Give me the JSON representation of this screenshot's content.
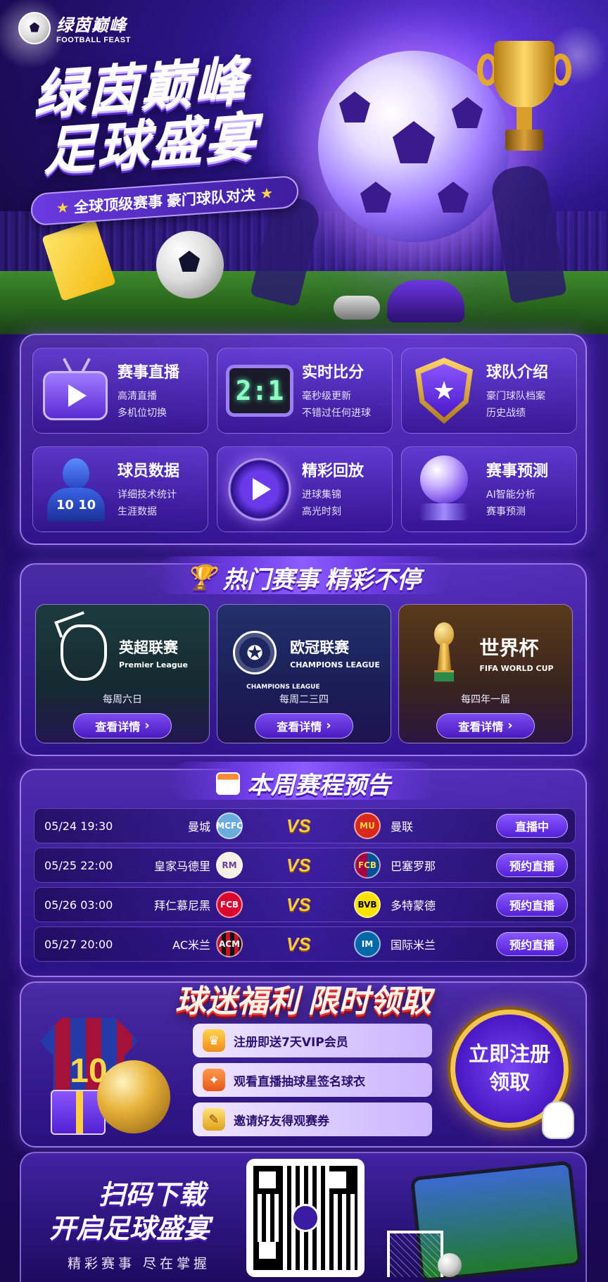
{
  "brand": {
    "name_cn": "绿茵巅峰",
    "name_en": "FOOTBALL FEAST"
  },
  "hero": {
    "title_line1": "绿茵巅峰",
    "title_line2": "足球盛宴",
    "subtitle": "全球顶级赛事 豪门球队对决",
    "star_glyph": "★"
  },
  "features": [
    {
      "title": "赛事直播",
      "desc1": "高清直播",
      "desc2": "多机位切换",
      "icon": "tv-play-icon"
    },
    {
      "title": "实时比分",
      "desc1": "毫秒级更新",
      "desc2": "不错过任何进球",
      "icon": "scoreboard-icon",
      "score": "2:1"
    },
    {
      "title": "球队介绍",
      "desc1": "豪门球队档案",
      "desc2": "历史战绩",
      "icon": "shield-star-icon"
    },
    {
      "title": "球员数据",
      "desc1": "详细技术统计",
      "desc2": "生涯数据",
      "icon": "player-icon",
      "jersey": "10 10"
    },
    {
      "title": "精彩回放",
      "desc1": "进球集锦",
      "desc2": "高光时刻",
      "icon": "replay-icon"
    },
    {
      "title": "赛事预测",
      "desc1": "AI智能分析",
      "desc2": "赛事预测",
      "icon": "crystal-ball-icon"
    }
  ],
  "leagues_section": {
    "title": "热门赛事 精彩不停",
    "items": [
      {
        "name": "英超联赛",
        "name_en": "Premier League",
        "schedule": "每周六日",
        "button": "查看详情"
      },
      {
        "name": "欧冠联赛",
        "name_en": "CHAMPIONS LEAGUE",
        "emblem_text": "CHAMPIONS LEAGUE",
        "schedule": "每周二三四",
        "button": "查看详情"
      },
      {
        "name": "世界杯",
        "name_en": "FIFA WORLD CUP",
        "schedule": "每四年一届",
        "button": "查看详情"
      }
    ]
  },
  "schedule": {
    "title": "本周赛程预告",
    "vs": "VS",
    "matches": [
      {
        "time": "05/24 19:30",
        "home": "曼城",
        "home_badge": "MCFC",
        "home_color": "#6cabdd",
        "away": "曼联",
        "away_badge": "MU",
        "away_color": "#da291c",
        "action": "直播中"
      },
      {
        "time": "05/25 22:00",
        "home": "皇家马德里",
        "home_badge": "RM",
        "home_color": "#f4f0e6",
        "away": "巴塞罗那",
        "away_badge": "FCB",
        "away_color": "#a50044",
        "action": "预约直播"
      },
      {
        "time": "05/26 03:00",
        "home": "拜仁慕尼黑",
        "home_badge": "FCB",
        "home_color": "#dc052d",
        "away": "多特蒙德",
        "away_badge": "BVB",
        "away_color": "#fde100",
        "action": "预约直播"
      },
      {
        "time": "05/27 20:00",
        "home": "AC米兰",
        "home_badge": "ACM",
        "home_color": "#c8102e",
        "away": "国际米兰",
        "away_badge": "IM",
        "away_color": "#0068a8",
        "action": "预约直播"
      }
    ]
  },
  "welfare": {
    "title": "球迷福利 限时领取",
    "jersey_number": "10",
    "items": [
      {
        "label": "注册即送7天VIP会员",
        "icon": "crown-icon",
        "glyph": "♛"
      },
      {
        "label": "观看直播抽球星签名球衣",
        "icon": "gift-icon",
        "glyph": "✦"
      },
      {
        "label": "邀请好友得观赛券",
        "icon": "ticket-icon",
        "glyph": "✎"
      }
    ],
    "cta_line1": "立即注册",
    "cta_line2": "领取"
  },
  "download": {
    "line1": "扫码下载",
    "line2": "开启足球盛宴",
    "sub": "精彩赛事 尽在掌握"
  }
}
